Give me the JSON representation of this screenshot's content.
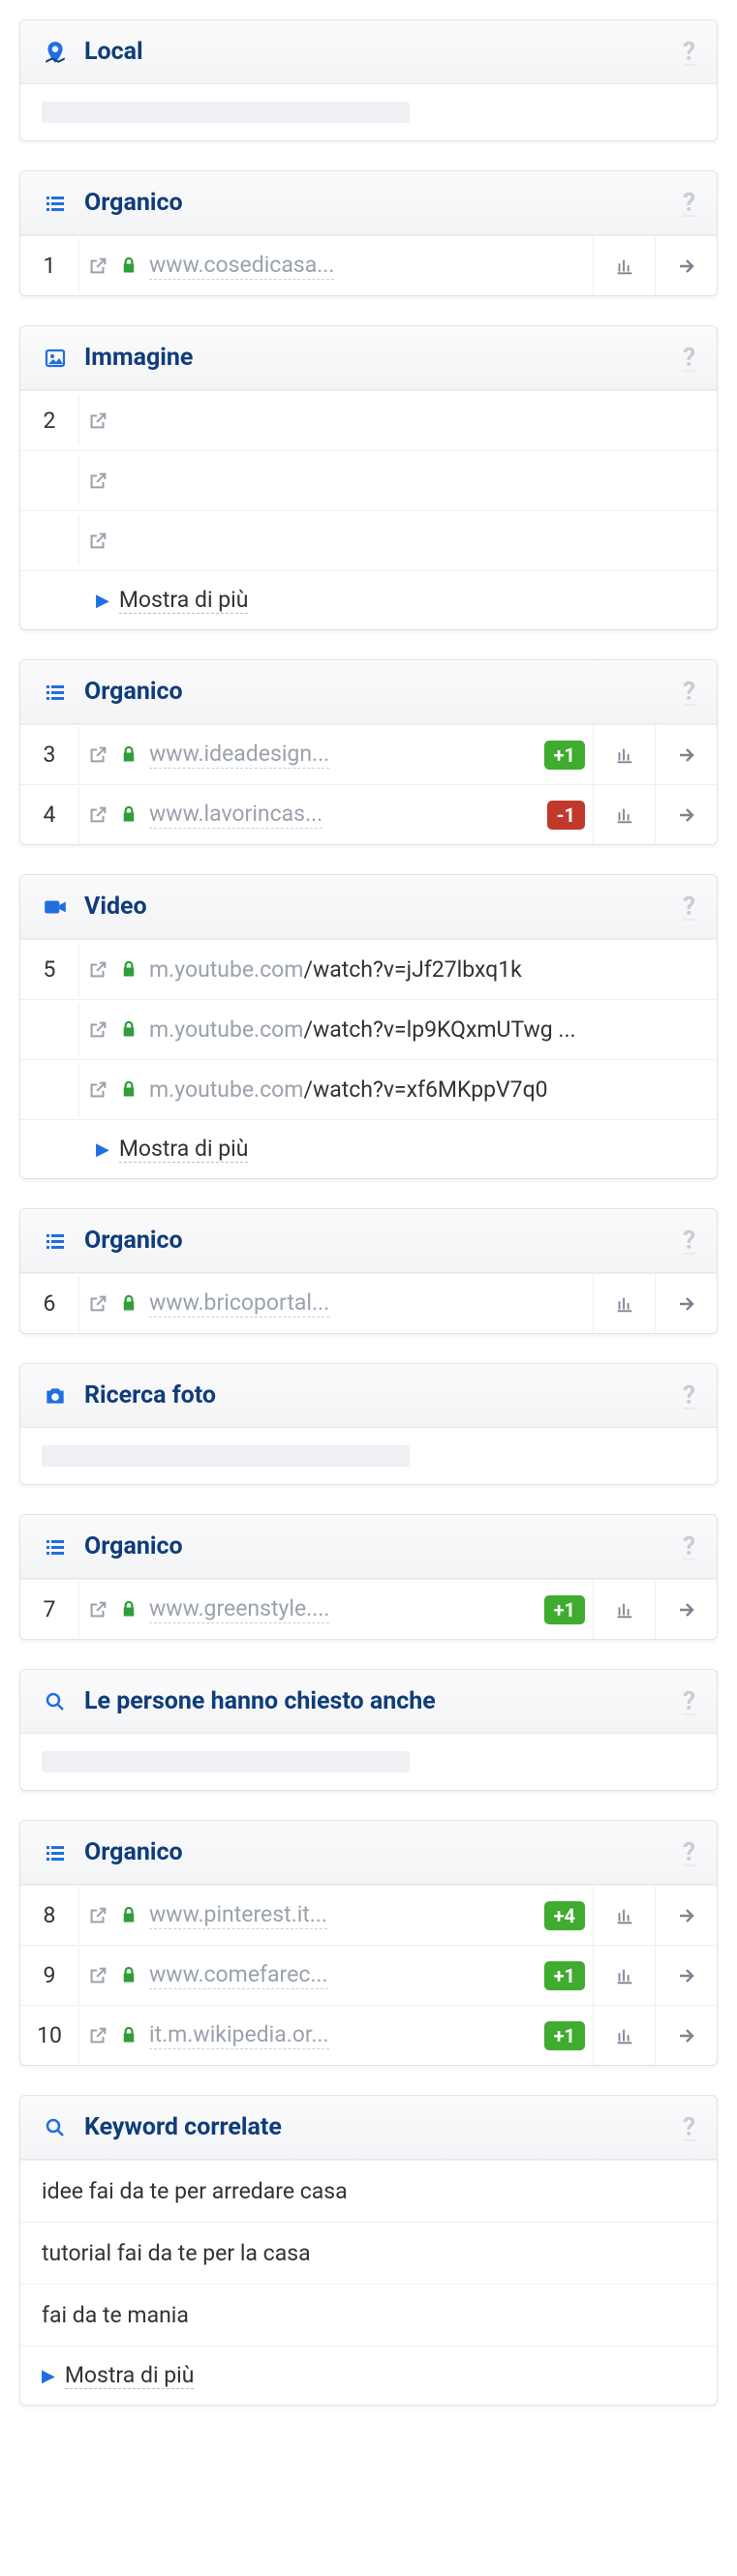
{
  "sections": [
    {
      "type": "local",
      "title": "Local",
      "placeholder": true
    },
    {
      "type": "organic",
      "title": "Organico",
      "rows": [
        {
          "pos": "1",
          "domain": "www.cosedicasa...",
          "chart": true,
          "arrow": true
        }
      ]
    },
    {
      "type": "image",
      "title": "Immagine",
      "rows": [
        {
          "pos": "2",
          "ext_only": true
        },
        {
          "pos": "",
          "ext_only": true
        },
        {
          "pos": "",
          "ext_only": true
        }
      ],
      "show_more": "Mostra di più"
    },
    {
      "type": "organic",
      "title": "Organico",
      "rows": [
        {
          "pos": "3",
          "domain": "www.ideadesign...",
          "badge": "+1",
          "badge_color": "green",
          "chart": true,
          "arrow": true
        },
        {
          "pos": "4",
          "domain": "www.lavorincas...",
          "badge": "-1",
          "badge_color": "red",
          "chart": true,
          "arrow": true
        }
      ]
    },
    {
      "type": "video",
      "title": "Video",
      "rows": [
        {
          "pos": "5",
          "domain": "m.youtube.com",
          "path": "/watch?v=jJf27lbxq1k"
        },
        {
          "pos": "",
          "domain": "m.youtube.com",
          "path": "/watch?v=lp9KQxmUTwg ..."
        },
        {
          "pos": "",
          "domain": "m.youtube.com",
          "path": "/watch?v=xf6MKppV7q0"
        }
      ],
      "show_more": "Mostra di più"
    },
    {
      "type": "organic",
      "title": "Organico",
      "rows": [
        {
          "pos": "6",
          "domain": "www.bricoportal...",
          "chart": true,
          "arrow": true
        }
      ]
    },
    {
      "type": "photo",
      "title": "Ricerca foto",
      "placeholder": true
    },
    {
      "type": "organic",
      "title": "Organico",
      "rows": [
        {
          "pos": "7",
          "domain": "www.greenstyle....",
          "badge": "+1",
          "badge_color": "green",
          "chart": true,
          "arrow": true
        }
      ]
    },
    {
      "type": "paa",
      "title": "Le persone hanno chiesto anche",
      "placeholder": true
    },
    {
      "type": "organic",
      "title": "Organico",
      "rows": [
        {
          "pos": "8",
          "domain": "www.pinterest.it...",
          "badge": "+4",
          "badge_color": "green",
          "chart": true,
          "arrow": true
        },
        {
          "pos": "9",
          "domain": "www.comefarec...",
          "badge": "+1",
          "badge_color": "green",
          "chart": true,
          "arrow": true
        },
        {
          "pos": "10",
          "domain": "it.m.wikipedia.or...",
          "badge": "+1",
          "badge_color": "green",
          "chart": true,
          "arrow": true
        }
      ]
    },
    {
      "type": "keywords",
      "title": "Keyword correlate",
      "items": [
        "idee fai da te per arredare casa",
        "tutorial fai da te per la casa",
        "fai da te mania"
      ],
      "show_more": "Mostra di più"
    }
  ],
  "icons": {
    "help": "?"
  }
}
